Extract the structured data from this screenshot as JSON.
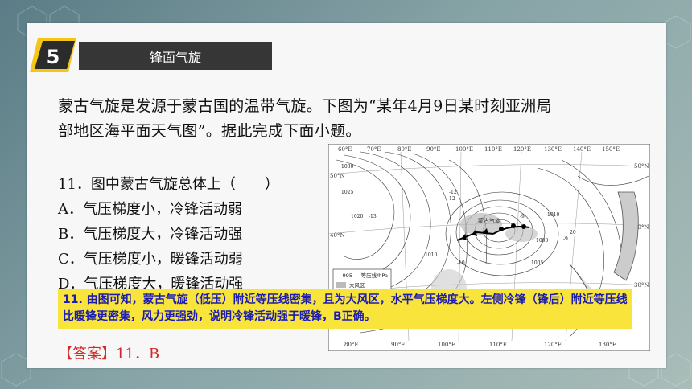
{
  "slide": {
    "number": "5",
    "title": "锋面气旋"
  },
  "intro": {
    "line1": "蒙古气旋是发源于蒙古国的温带气旋。下图为“某年4月9日某时刻亚洲局",
    "line2": "部地区海平面天气图”。据此完成下面小题。"
  },
  "question": {
    "stem": "11．图中蒙古气旋总体上（　　）",
    "options": [
      "A．气压梯度小，冷锋活动弱",
      "B．气压梯度大，冷锋活动强",
      "C．气压梯度小，暖锋活动弱",
      "D．气压梯度大，暖锋活动强"
    ]
  },
  "map": {
    "top_lon_labels": [
      "60°E",
      "70°E",
      "80°E",
      "90°E",
      "100°E",
      "110°E",
      "120°E",
      "130°E",
      "140°E",
      "150°E"
    ],
    "bottom_lon_labels": [
      "80°E",
      "90°E",
      "100°E",
      "110°E",
      "120°E",
      "130°E"
    ],
    "left_lat_labels": [
      "50°N",
      "40°N"
    ],
    "right_lat_labels": [
      "50°N",
      "40°N",
      "30°N"
    ],
    "legend_isobar": "— 995 — 等压线/hPa",
    "legend_wind": "大风区",
    "pressure_labels": [
      "1030",
      "1025",
      "1020",
      "1010",
      "1005",
      "1000",
      "1010"
    ],
    "temperature_labels": [
      "-13",
      "-12",
      "12",
      "-9",
      "-10",
      "-9",
      "20"
    ],
    "low_center_label": "蒙古气旋"
  },
  "answer": {
    "explanation": "11. 由图可知，蒙古气旋（低压）附近等压线密集，且为大风区，水平气压梯度大。左侧冷锋（锋后）附近等压线比暖锋更密集，风力更强劲，说明冷锋活动强于暖锋，B正确。",
    "key": "【答案】11．B"
  }
}
